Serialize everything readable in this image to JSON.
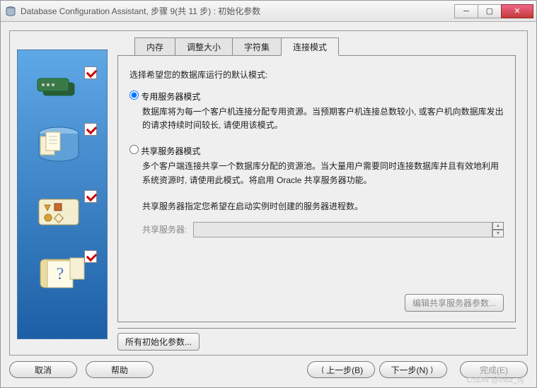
{
  "window": {
    "title": "Database Configuration Assistant, 步骤 9(共 11 步) : 初始化参数"
  },
  "tabs": {
    "memory": "内存",
    "resize": "调整大小",
    "charset": "字符集",
    "connmode": "连接模式"
  },
  "panel": {
    "intro": "选择希望您的数据库运行的默认模式:",
    "dedicated": {
      "label": "专用服务器模式",
      "desc": "数据库将为每一个客户机连接分配专用资源。当预期客户机连接总数较小, 或客户机向数据库发出的请求持续时间较长, 请使用该模式。",
      "selected": true
    },
    "shared": {
      "label": "共享服务器模式",
      "desc": "多个客户端连接共享一个数据库分配的资源池。当大量用户需要同时连接数据库并且有效地利用系统资源时, 请使用此模式。将启用 Oracle 共享服务器功能。",
      "selected": false,
      "note": "共享服务器指定您希望在启动实例时创建的服务器进程数。",
      "field_label": "共享服务器:",
      "field_value": ""
    },
    "edit_button": "编辑共享服务器参数...",
    "all_params": "所有初始化参数..."
  },
  "footer": {
    "cancel": "取消",
    "help": "帮助",
    "back": "上一步(B)",
    "next": "下一步(N)",
    "finish": "完成(E)"
  },
  "watermark": "CSDN @lhdz_bj"
}
